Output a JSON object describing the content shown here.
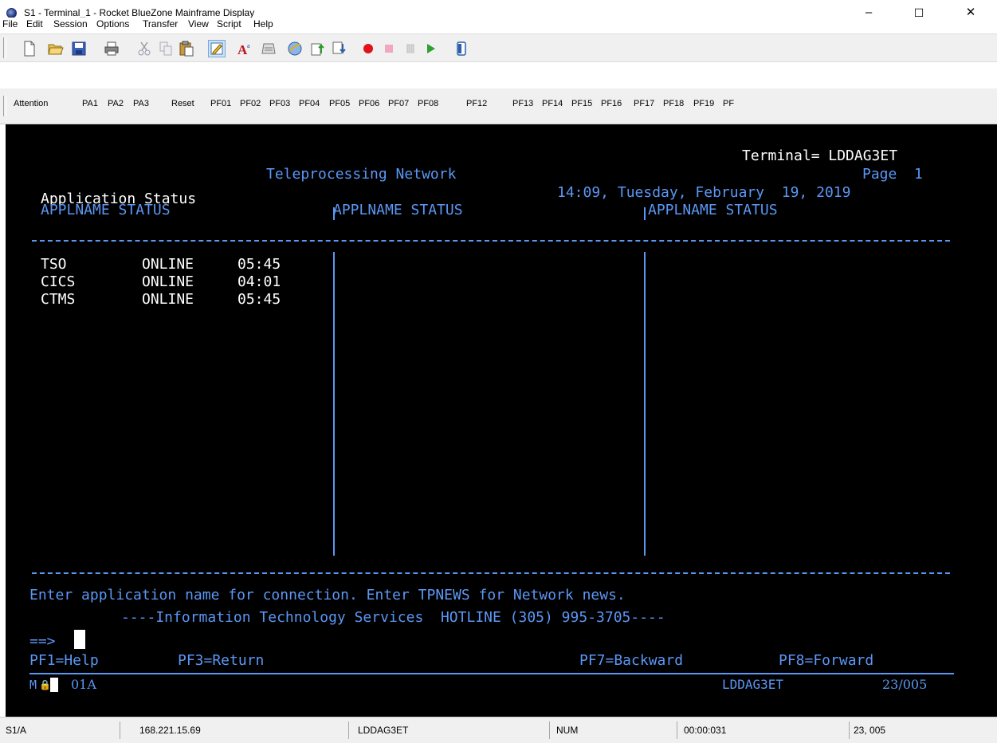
{
  "window": {
    "title": "S1 - Terminal_1 - Rocket BlueZone Mainframe Display",
    "minimize": "–",
    "maximize": "☐",
    "close": "✕"
  },
  "menu": [
    "File",
    "Edit",
    "Session",
    "Options",
    "Transfer",
    "View",
    "Script",
    "Help"
  ],
  "keys": [
    "Attention",
    "PA1",
    "PA2",
    "PA3",
    "Reset",
    "PF01",
    "PF02",
    "PF03",
    "PF04",
    "PF05",
    "PF06",
    "PF07",
    "PF08",
    "PF12",
    "PF13",
    "PF14",
    "PF15",
    "PF16",
    "PF17",
    "PF18",
    "PF19",
    "PF"
  ],
  "terminal": {
    "terminal_id": "Terminal= LDDAG3ET",
    "network_title": "Teleprocessing Network",
    "page": "Page  1",
    "app_status_title": "Application Status",
    "datetime": "14:09, Tuesday, February  19, 2019",
    "col_header_1": "APPLNAME STATUS",
    "col_header_2": "APPLNAME STATUS",
    "col_header_3": "APPLNAME STATUS",
    "rows": [
      {
        "name": "TSO",
        "status": "ONLINE",
        "time": "05:45"
      },
      {
        "name": "CICS",
        "status": "ONLINE",
        "time": "04:01"
      },
      {
        "name": "CTMS",
        "status": "ONLINE",
        "time": "05:45"
      }
    ],
    "instruction": "Enter application name for connection. Enter TPNEWS for Network news.",
    "hotline": "----Information Technology Services  HOTLINE (305) 995-3705----",
    "prompt": "==>",
    "pf1": "PF1=Help",
    "pf3": "PF3=Return",
    "pf7": "PF7=Backward",
    "pf8": "PF8=Forward",
    "oia_left": "M",
    "oia_lock": "🔒",
    "oia_session": "01A",
    "oia_luname": "LDDAG3ET",
    "oia_cursor": "23/005"
  },
  "status": {
    "session": "S1/A",
    "ip": "168.221.15.69",
    "luname": "LDDAG3ET",
    "numlock": "NUM",
    "timer": "00:00:031",
    "position": "23, 005"
  }
}
